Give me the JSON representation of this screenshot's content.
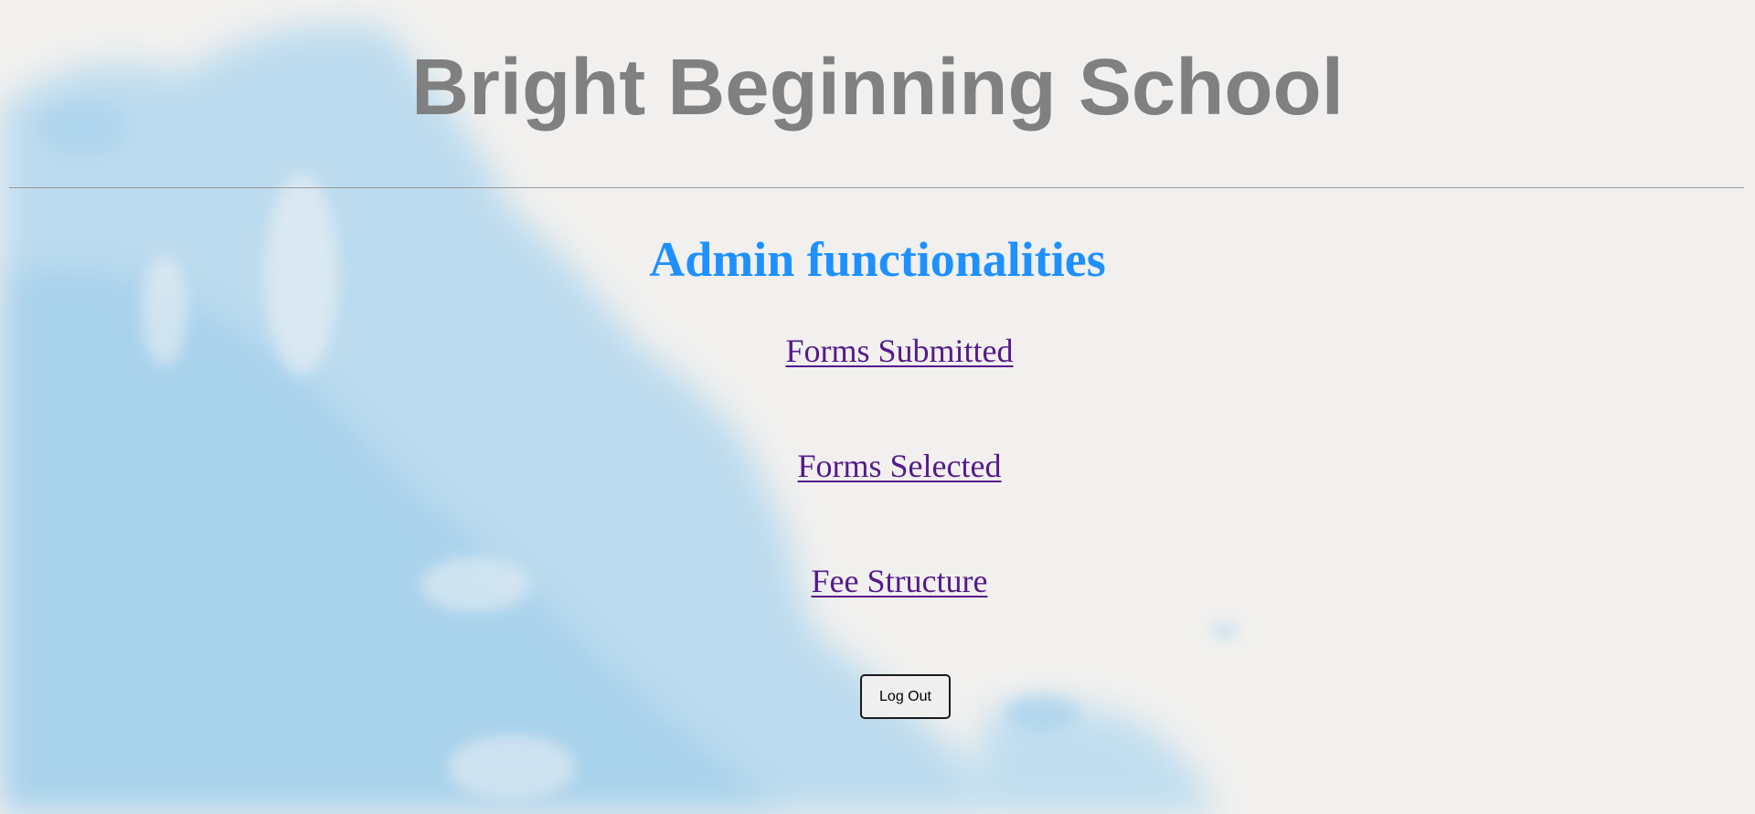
{
  "header": {
    "title": "Bright Beginning School"
  },
  "main": {
    "heading": "Admin functionalities",
    "links": [
      {
        "label": "Forms Submitted"
      },
      {
        "label": "Forms Selected"
      },
      {
        "label": "Fee Structure"
      }
    ],
    "logout_label": "Log Out"
  },
  "colors": {
    "title": "#808080",
    "heading": "#1e90ff",
    "link": "#551a8b",
    "watercolor": "#a9d3ee",
    "paper": "#f1f0ee"
  },
  "decorations": {
    "background": "watercolor-paper-texture"
  }
}
